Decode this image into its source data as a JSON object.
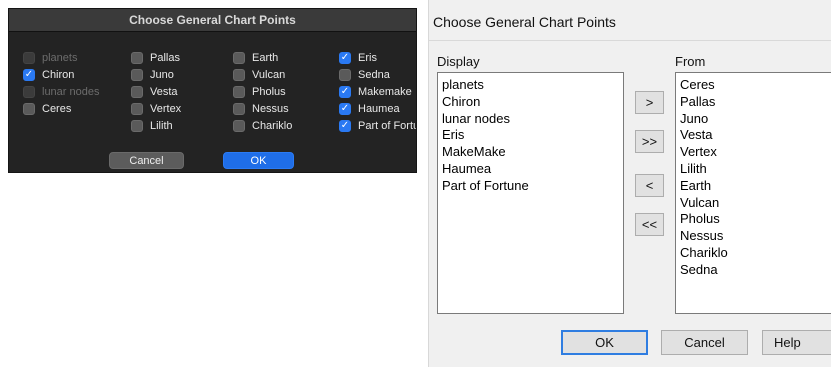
{
  "mac_dialog": {
    "title": "Choose General Chart Points",
    "columns": [
      [
        {
          "label": "planets",
          "checked": false,
          "disabled": true
        },
        {
          "label": "Chiron",
          "checked": true,
          "disabled": false
        },
        {
          "label": "lunar nodes",
          "checked": false,
          "disabled": true
        },
        {
          "label": "Ceres",
          "checked": false,
          "disabled": false
        }
      ],
      [
        {
          "label": "Pallas",
          "checked": false,
          "disabled": false
        },
        {
          "label": "Juno",
          "checked": false,
          "disabled": false
        },
        {
          "label": "Vesta",
          "checked": false,
          "disabled": false
        },
        {
          "label": "Vertex",
          "checked": false,
          "disabled": false
        },
        {
          "label": "Lilith",
          "checked": false,
          "disabled": false
        }
      ],
      [
        {
          "label": "Earth",
          "checked": false,
          "disabled": false
        },
        {
          "label": "Vulcan",
          "checked": false,
          "disabled": false
        },
        {
          "label": "Pholus",
          "checked": false,
          "disabled": false
        },
        {
          "label": "Nessus",
          "checked": false,
          "disabled": false
        },
        {
          "label": "Chariklo",
          "checked": false,
          "disabled": false
        }
      ],
      [
        {
          "label": "Eris",
          "checked": true,
          "disabled": false
        },
        {
          "label": "Sedna",
          "checked": false,
          "disabled": false
        },
        {
          "label": "Makemake",
          "checked": true,
          "disabled": false
        },
        {
          "label": "Haumea",
          "checked": true,
          "disabled": false
        },
        {
          "label": "Part of Fortune",
          "checked": true,
          "disabled": false
        }
      ]
    ],
    "cancel_label": "Cancel",
    "ok_label": "OK",
    "colors": {
      "accent": "#1f6ee8",
      "background": "#232323"
    }
  },
  "win_dialog": {
    "title": "Choose General Chart Points",
    "display_label": "Display",
    "from_label": "From",
    "display_items": [
      "planets",
      "Chiron",
      "lunar nodes",
      "Eris",
      "MakeMake",
      "Haumea",
      "Part of Fortune"
    ],
    "from_items": [
      "Ceres",
      "Pallas",
      "Juno",
      "Vesta",
      "Vertex",
      "Lilith",
      "Earth",
      "Vulcan",
      "Pholus",
      "Nessus",
      "Chariklo",
      "Sedna"
    ],
    "move_right_label": ">",
    "move_all_right_label": ">>",
    "move_left_label": "<",
    "move_all_left_label": "<<",
    "ok_label": "OK",
    "cancel_label": "Cancel",
    "help_label": "Help",
    "colors": {
      "default_button_border": "#2f7de1",
      "background": "#f0f0f0"
    }
  }
}
